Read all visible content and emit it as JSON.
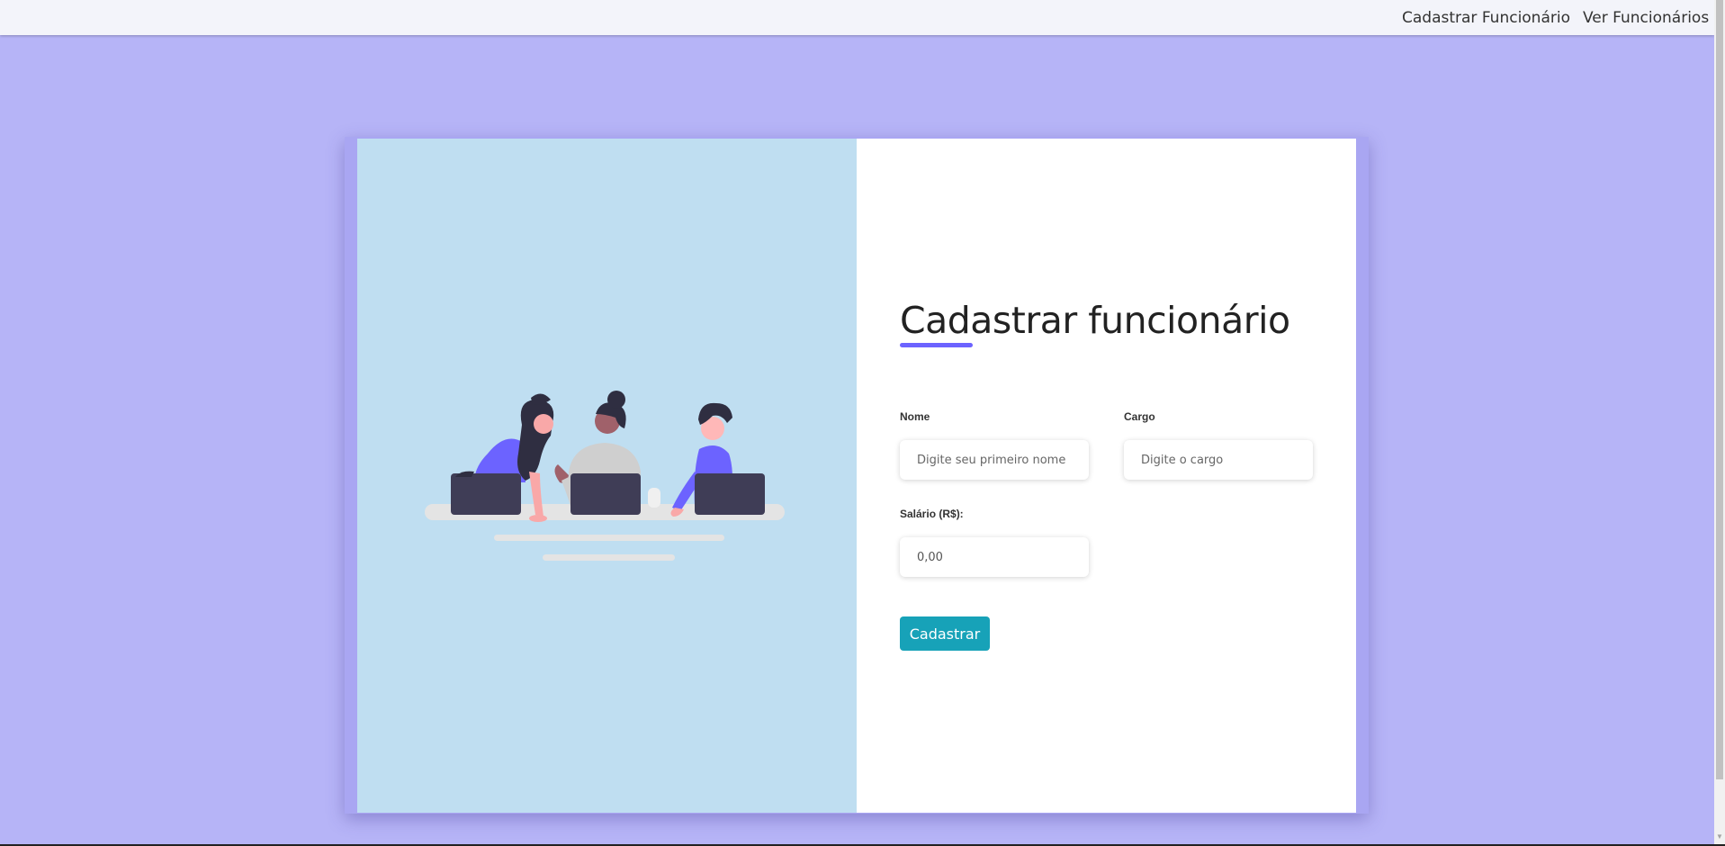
{
  "nav": {
    "links": [
      "Cadastrar Funcionário",
      "Ver Funcionários"
    ]
  },
  "form": {
    "title": "Cadastrar funcionário",
    "fields": {
      "nome": {
        "label": "Nome",
        "placeholder": "Digite seu primeiro nome",
        "value": ""
      },
      "cargo": {
        "label": "Cargo",
        "placeholder": "Digite o cargo",
        "value": ""
      },
      "salario": {
        "label": "Salário (R$):",
        "placeholder": "",
        "value": "0,00"
      }
    },
    "submit_label": "Cadastrar"
  },
  "colors": {
    "page_background": "#b6b4f7",
    "illustration_panel": "#bfdef1",
    "accent": "#6c63ff",
    "button": "#17a2b8"
  }
}
